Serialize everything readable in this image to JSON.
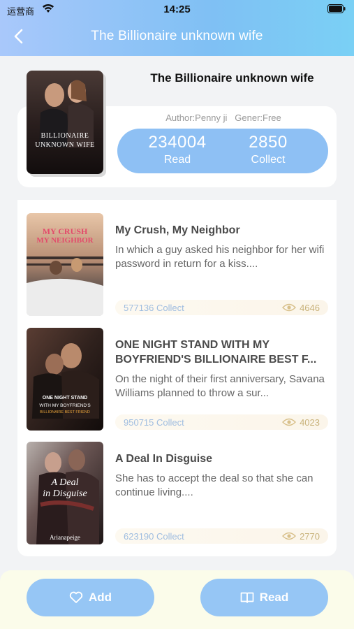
{
  "status": {
    "carrier": "运营商",
    "time": "14:25"
  },
  "nav": {
    "title": "The Billionaire unknown wife",
    "back_icon": "chevron-left-icon"
  },
  "book": {
    "title": "The Billionaire unknown wife",
    "author_label": "Author:",
    "author": "Penny ji",
    "genre_label": "Gener:",
    "genre": "Free",
    "cover_text": "BILLIONAIRE UNKNOWN WIFE",
    "read_count": "234004",
    "read_label": "Read",
    "collect_count": "2850",
    "collect_label": "Collect"
  },
  "list": [
    {
      "title": "My Crush, My Neighbor",
      "desc": "In which a guy asked his neighbor for her wifi password in return for a kiss....",
      "collect": "577136 Collect",
      "views": "4646",
      "cover_text": "MY CRUSH MY NEIGHBOR"
    },
    {
      "title": "ONE NIGHT STAND WITH MY BOYFRIEND'S BILLIONAIRE BEST F...",
      "desc": "On the night of their first anniversary, Savana Williams planned to throw a sur...",
      "collect": "950715 Collect",
      "views": "4023",
      "cover_text": "ONE NIGHT STAND WITH MY BOYFRIEND'S BILLIONAIRE BEST FRIEND"
    },
    {
      "title": "A Deal In Disguise",
      "desc": "She has to accept the deal so that she can continue living....",
      "collect": "623190 Collect",
      "views": "2770",
      "cover_text": "A Deal in Disguise",
      "cover_author": "Arianapeige"
    }
  ],
  "bottom": {
    "add_label": "Add",
    "add_icon": "heart-icon",
    "read_label": "Read",
    "read_icon": "book-icon"
  },
  "colors": {
    "accent": "#8ec0f4",
    "header_start": "#a9c8fb",
    "header_end": "#7ad0f5",
    "views": "#c8b27a",
    "collect": "#9fbde0"
  }
}
